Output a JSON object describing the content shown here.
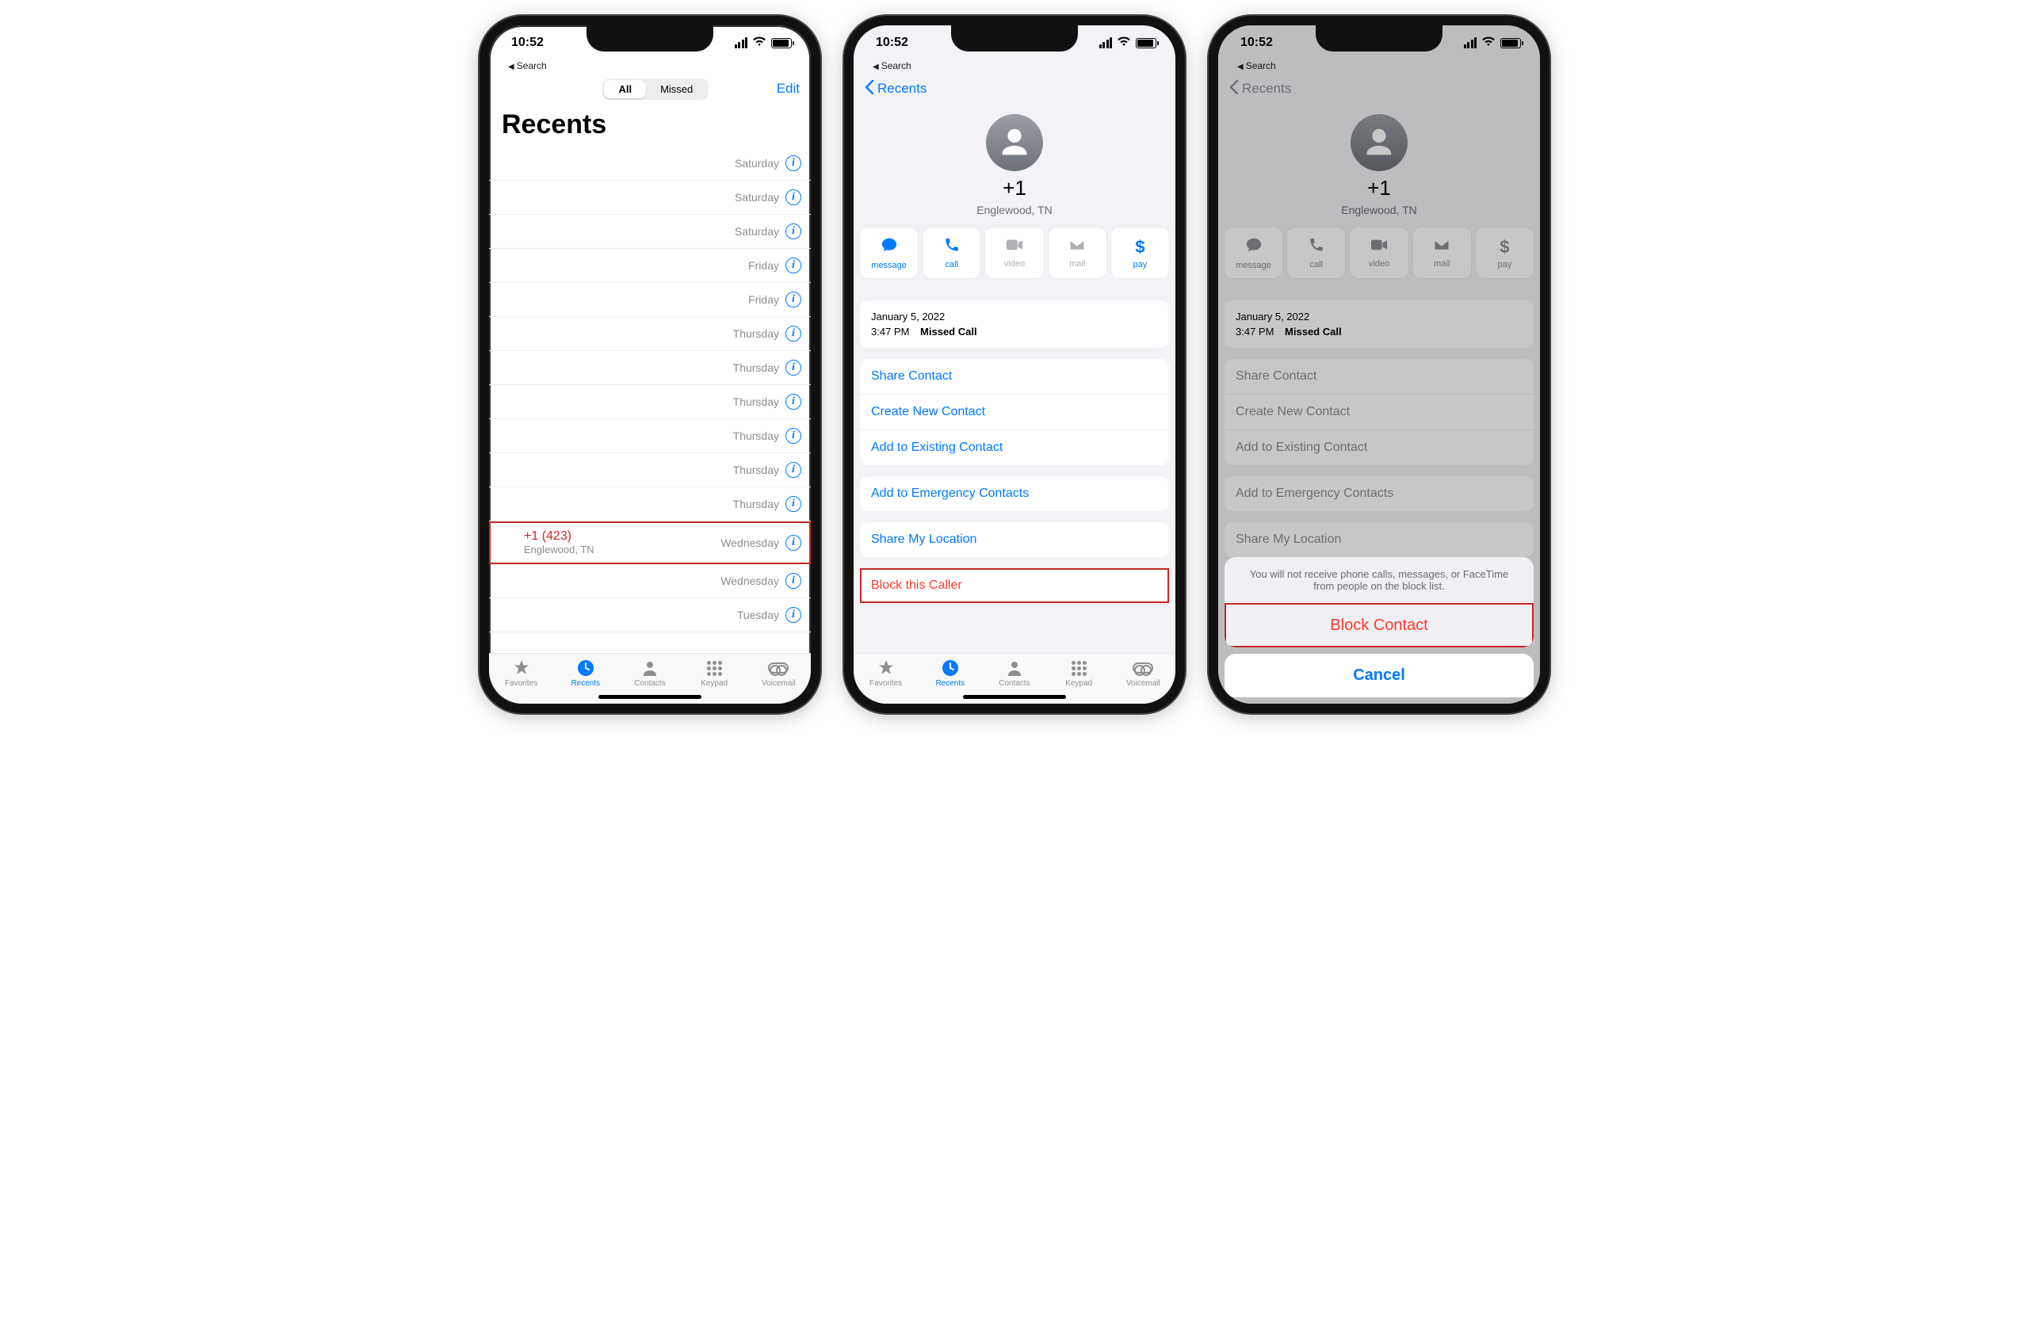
{
  "status": {
    "time": "10:52",
    "back_crumb": "Search"
  },
  "colors": {
    "ios_blue": "#007aff",
    "ios_red": "#ff3b30",
    "missed_red": "#c62828",
    "gray": "#8e8e93"
  },
  "tabs": [
    {
      "label": "Favorites"
    },
    {
      "label": "Recents"
    },
    {
      "label": "Contacts"
    },
    {
      "label": "Keypad"
    },
    {
      "label": "Voicemail"
    }
  ],
  "phone1": {
    "seg_all": "All",
    "seg_missed": "Missed",
    "edit": "Edit",
    "title": "Recents",
    "rows": [
      {
        "time": "Saturday"
      },
      {
        "time": "Saturday"
      },
      {
        "time": "Saturday"
      },
      {
        "time": "Friday"
      },
      {
        "time": "Friday"
      },
      {
        "time": "Thursday"
      },
      {
        "time": "Thursday"
      },
      {
        "time": "Thursday"
      },
      {
        "time": "Thursday"
      },
      {
        "time": "Thursday"
      },
      {
        "time": "Thursday"
      },
      {
        "time": "Wednesday",
        "highlight": true,
        "number": "+1 (423)",
        "sub": "Englewood, TN"
      },
      {
        "time": "Wednesday"
      },
      {
        "time": "Tuesday"
      }
    ]
  },
  "phone2": {
    "back": "Recents",
    "number": "+1",
    "location": "Englewood, TN",
    "actions": [
      {
        "label": "message",
        "enabled": true,
        "icon": "message-icon"
      },
      {
        "label": "call",
        "enabled": true,
        "icon": "phone-icon"
      },
      {
        "label": "video",
        "enabled": false,
        "icon": "video-icon"
      },
      {
        "label": "mail",
        "enabled": false,
        "icon": "mail-icon"
      },
      {
        "label": "pay",
        "enabled": true,
        "icon": "dollar-icon"
      }
    ],
    "log_date": "January 5, 2022",
    "log_time": "3:47 PM",
    "log_kind": "Missed Call",
    "links1": [
      "Share Contact",
      "Create New Contact",
      "Add to Existing Contact"
    ],
    "links2": [
      "Add to Emergency Contacts"
    ],
    "links3": [
      "Share My Location"
    ],
    "block": "Block this Caller"
  },
  "phone3": {
    "sheet_message": "You will not receive phone calls, messages, or FaceTime from people on the block list.",
    "sheet_action": "Block Contact",
    "sheet_cancel": "Cancel"
  }
}
